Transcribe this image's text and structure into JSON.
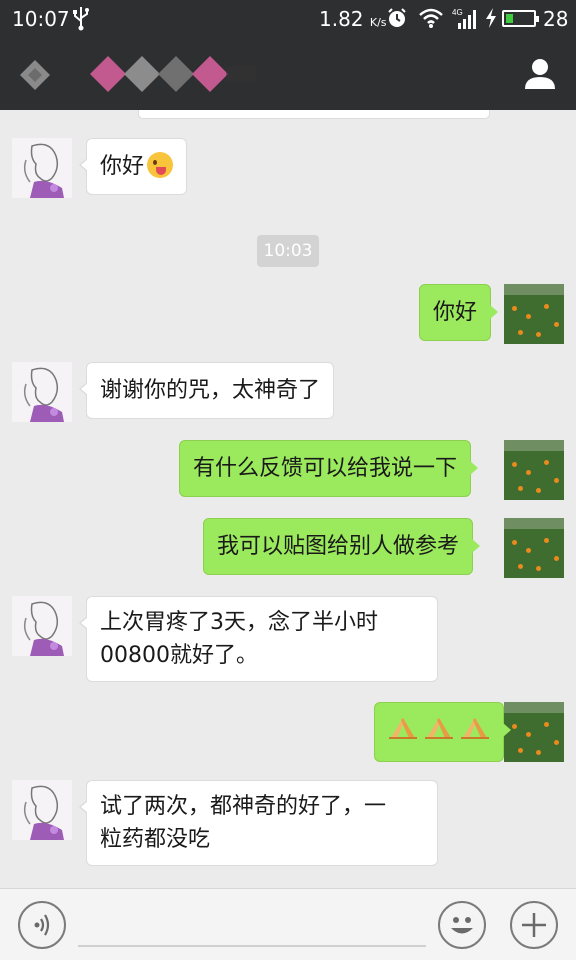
{
  "status_bar": {
    "time": "10:07",
    "net_speed": "1.82",
    "net_unit": "K/s",
    "network_type": "4G",
    "battery_level": "28",
    "battery_fraction": 0.28,
    "icons": [
      "usb-icon",
      "alarm-icon",
      "wifi-icon",
      "signal-icon",
      "charging-icon",
      "battery-icon"
    ]
  },
  "title_bar": {
    "icons": [
      "back-icon",
      "profile-icon"
    ]
  },
  "chat": {
    "timestamp": "10:03",
    "messages": [
      {
        "from": "contact",
        "text": "你好",
        "emoji": "wink-tongue-emoji"
      },
      {
        "from": "me",
        "text": "你好"
      },
      {
        "from": "contact",
        "text": "谢谢你的咒，太神奇了"
      },
      {
        "from": "me",
        "text": "有什么反馈可以给我说一下"
      },
      {
        "from": "me",
        "text": "我可以贴图给别人做参考"
      },
      {
        "from": "contact",
        "text_line1": "上次胃疼了3天，念了半小时",
        "text_line2": "00800就好了。"
      },
      {
        "from": "me",
        "emoji": "pray-emoji",
        "count": 3
      },
      {
        "from": "contact",
        "text_line1": "试了两次，都神奇的好了，一",
        "text_line2": "粒药都没吃"
      }
    ]
  },
  "input_bar": {
    "value": "",
    "icons": [
      "voice-icon",
      "emoji-icon",
      "plus-icon"
    ]
  },
  "colors": {
    "bar": "#2e2f31",
    "background": "#ebebeb",
    "outgoing_bubble": "#9be95c",
    "incoming_bubble": "#ffffff"
  }
}
